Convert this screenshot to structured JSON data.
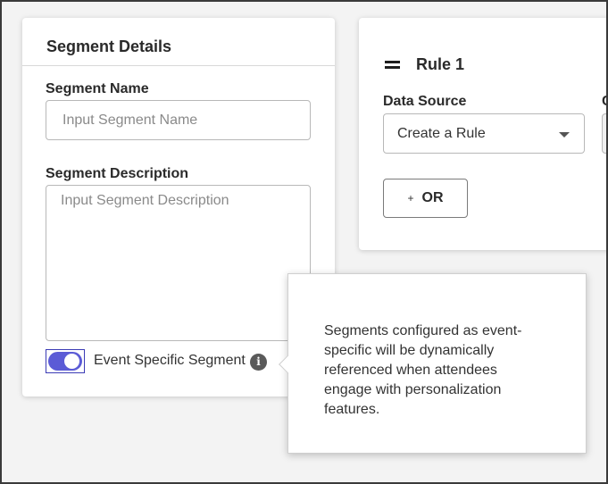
{
  "segment_details": {
    "title": "Segment Details",
    "name_label": "Segment Name",
    "name_placeholder": "Input Segment Name",
    "description_label": "Segment Description",
    "description_placeholder": "Input Segment Description",
    "event_specific_toggle": {
      "label": "Event Specific Segment",
      "on": true,
      "info_icon": "i"
    }
  },
  "rule": {
    "title": "Rule 1",
    "drag_icon": "drag-handle-icon",
    "data_source_label": "Data Source",
    "data_source_value": "Create a Rule",
    "second_label": "C",
    "or_button_plus": "+",
    "or_button_label": "OR"
  },
  "tooltip": {
    "text": "Segments configured as event-specific will be dynamically referenced when attendees engage with personalization features."
  },
  "colors": {
    "toggle_on": "#5b5bd6",
    "toggle_border": "#3b3bb5",
    "info_icon_bg": "#5a5a5a"
  }
}
